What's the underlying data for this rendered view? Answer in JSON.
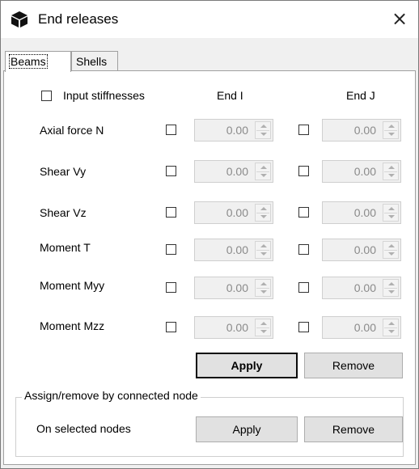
{
  "window": {
    "title": "End releases",
    "close_glyph": "×",
    "icon": "cube-icon"
  },
  "tabs": [
    {
      "label": "Beams",
      "active": true
    },
    {
      "label": "Shells",
      "active": false
    }
  ],
  "beams": {
    "input_stiffnesses_label": "Input stiffnesses",
    "input_stiffnesses_checked": false,
    "end_i_header": "End I",
    "end_j_header": "End J",
    "rows": [
      {
        "label": "Axial force N",
        "end_i": "0.00",
        "end_j": "0.00"
      },
      {
        "label": "Shear Vy",
        "end_i": "0.00",
        "end_j": "0.00"
      },
      {
        "label": "Shear Vz",
        "end_i": "0.00",
        "end_j": "0.00"
      },
      {
        "label": "Moment T",
        "end_i": "0.00",
        "end_j": "0.00"
      },
      {
        "label": "Moment Myy",
        "end_i": "0.00",
        "end_j": "0.00"
      },
      {
        "label": "Moment Mzz",
        "end_i": "0.00",
        "end_j": "0.00"
      }
    ],
    "apply_label": "Apply",
    "remove_label": "Remove"
  },
  "connected_node": {
    "group_title": "Assign/remove by connected node",
    "label": "On selected nodes",
    "apply_label": "Apply",
    "remove_label": "Remove"
  }
}
